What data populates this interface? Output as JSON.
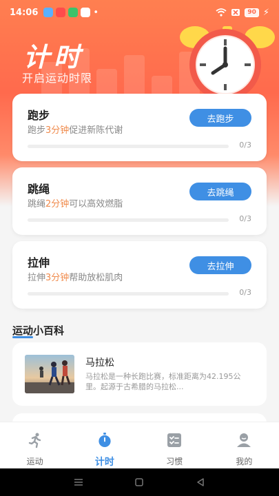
{
  "status_bar": {
    "time": "14:06",
    "battery": "90"
  },
  "header": {
    "title": "计时",
    "subtitle": "开启运动时限"
  },
  "cards": [
    {
      "title": "跑步",
      "desc_pre": "跑步",
      "desc_hl": "3分钟",
      "desc_post": "促进新陈代谢",
      "button": "去跑步",
      "progress": "0/3",
      "progress_fraction": 0
    },
    {
      "title": "跳绳",
      "desc_pre": "跳绳",
      "desc_hl": "2分钟",
      "desc_post": "可以高效燃脂",
      "button": "去跳绳",
      "progress": "0/3",
      "progress_fraction": 0
    },
    {
      "title": "拉伸",
      "desc_pre": "拉伸",
      "desc_hl": "3分钟",
      "desc_post": "帮助放松肌肉",
      "button": "去拉伸",
      "progress": "0/3",
      "progress_fraction": 0
    }
  ],
  "section": {
    "title": "运动小百科"
  },
  "articles": [
    {
      "title": "马拉松",
      "text": "马拉松是一种长跑比赛，标准距离为42.195公里。起源于古希腊的马拉松..."
    }
  ],
  "tabs": [
    {
      "label": "运动",
      "icon": "running-icon",
      "active": false
    },
    {
      "label": "计时",
      "icon": "stopwatch-icon",
      "active": true
    },
    {
      "label": "习惯",
      "icon": "checklist-icon",
      "active": false
    },
    {
      "label": "我的",
      "icon": "profile-icon",
      "active": false
    }
  ],
  "colors": {
    "accent": "#3f8fe4",
    "highlight": "#f08a4b",
    "header": "#ff6a4d"
  }
}
